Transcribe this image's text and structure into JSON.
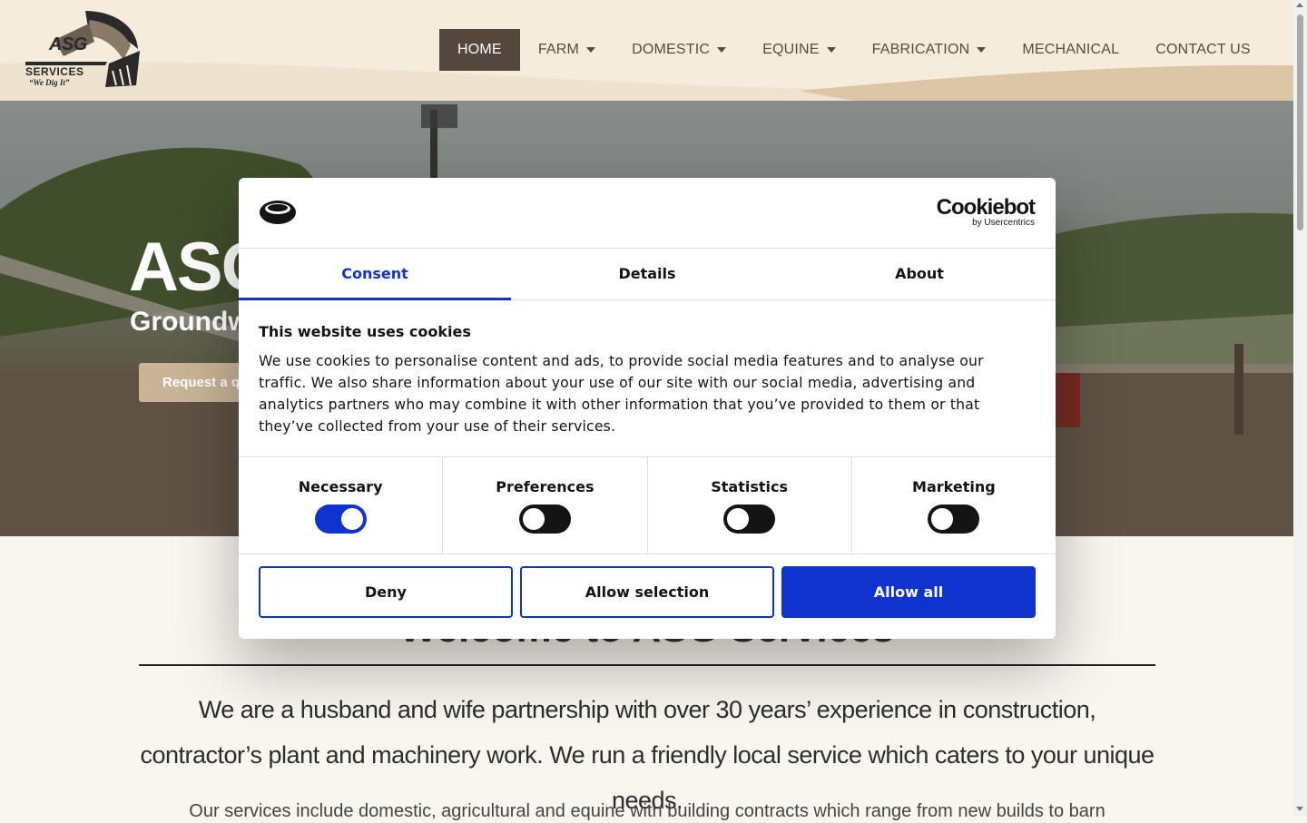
{
  "logo": {
    "name": "ASG",
    "services": "SERVICES",
    "tagline": "“We Dig It”"
  },
  "nav": {
    "items": [
      {
        "label": "HOME",
        "active": true,
        "dropdown": false
      },
      {
        "label": "FARM",
        "active": false,
        "dropdown": true
      },
      {
        "label": "DOMESTIC",
        "active": false,
        "dropdown": true
      },
      {
        "label": "EQUINE",
        "active": false,
        "dropdown": true
      },
      {
        "label": "FABRICATION",
        "active": false,
        "dropdown": true
      },
      {
        "label": "MECHANICAL",
        "active": false,
        "dropdown": false
      },
      {
        "label": "CONTACT US",
        "active": false,
        "dropdown": false
      }
    ]
  },
  "hero": {
    "title": "ASG",
    "subtitle": "Groundw",
    "button_label": "Request a qu"
  },
  "main": {
    "welcome": "Welcome to ASG Services",
    "lead": "We are a husband and wife partnership with over 30 years’ experience in construction, contractor’s plant and machinery work. We run a friendly local service which caters to your unique needs.",
    "body": "Our services include domestic, agricultural and equine with building contracts which range from new builds to barn"
  },
  "cookie_dialog": {
    "brand": "Cookiebot",
    "brand_by": "by Usercentrics",
    "tabs": [
      {
        "label": "Consent",
        "active": true
      },
      {
        "label": "Details",
        "active": false
      },
      {
        "label": "About",
        "active": false
      }
    ],
    "heading": "This website uses cookies",
    "text": "We use cookies to personalise content and ads, to provide social media features and to analyse our traffic. We also share information about your use of our site with our social media, advertising and analytics partners who may combine it with other information that you’ve provided to them or that they’ve collected from your use of their services.",
    "toggles": [
      {
        "label": "Necessary",
        "on": true
      },
      {
        "label": "Preferences",
        "on": false
      },
      {
        "label": "Statistics",
        "on": false
      },
      {
        "label": "Marketing",
        "on": false
      }
    ],
    "buttons": {
      "deny": "Deny",
      "allow_selection": "Allow selection",
      "allow_all": "Allow all"
    }
  },
  "colors": {
    "accent": "#1032cf",
    "nav_active_bg": "#54473d",
    "header_bg": "#f6ecdc",
    "hero_button": "#c9b497"
  }
}
